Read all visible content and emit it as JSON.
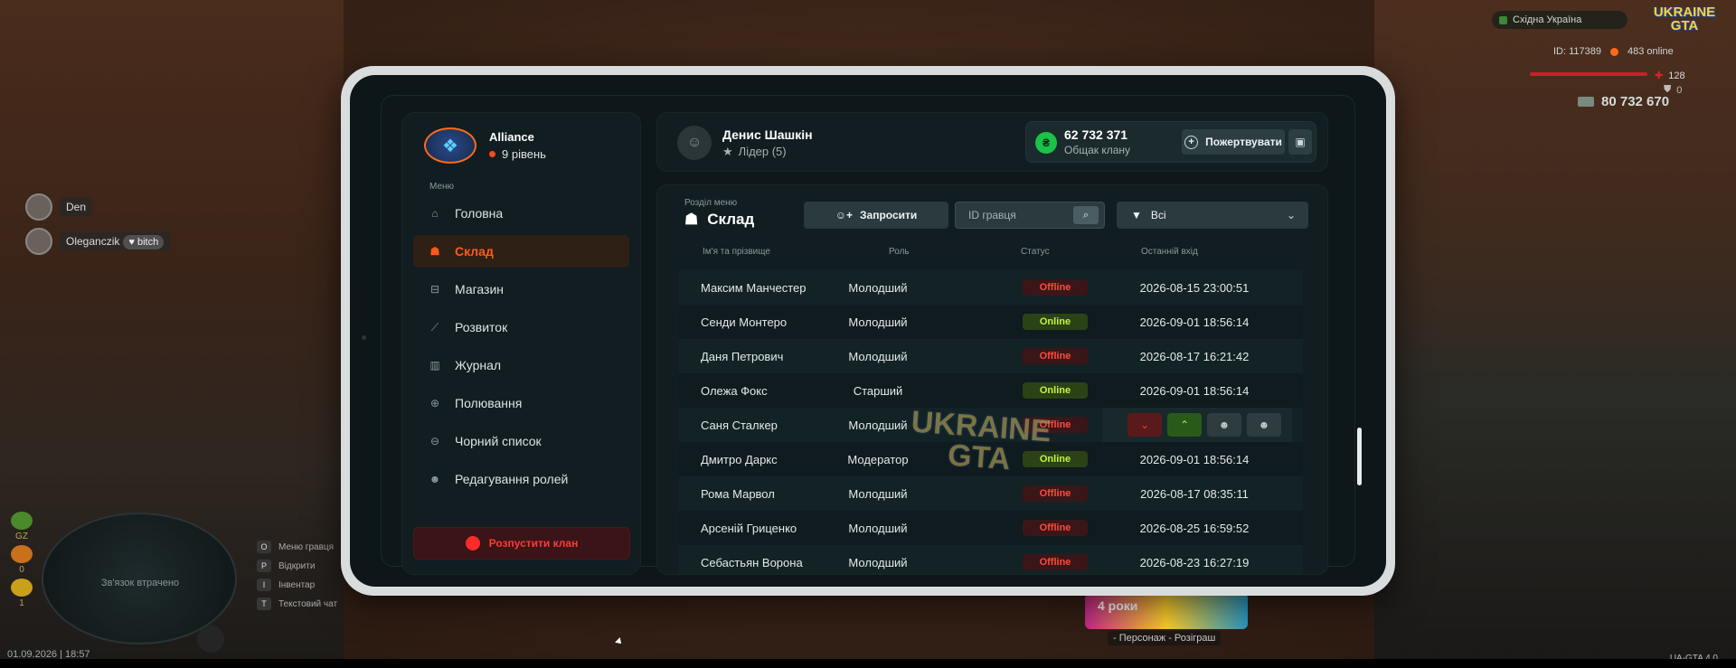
{
  "hud": {
    "region": "Східна Україна",
    "logo_text": "UKRAINE GTA",
    "player_id": "ID: 117389",
    "online": "483 online",
    "health": "128",
    "armor": "0",
    "money": "80 732 670",
    "datetime": "01.09.2026 | 18:57",
    "version": "UA-GTA 4.0",
    "minimap_status": "Зв'язок втрачено",
    "status_labels": [
      "GZ",
      "0",
      "1"
    ],
    "keyhints": [
      {
        "key": "O",
        "label": "Меню гравця"
      },
      {
        "key": "P",
        "label": "Відкрити"
      },
      {
        "key": "I",
        "label": "Інвентар"
      },
      {
        "key": "T",
        "label": "Текстовий чат"
      }
    ],
    "promo_text": "4 роки",
    "promo_caption": "- Персонаж - Розіграш"
  },
  "voice": [
    {
      "name": "Den",
      "tag": ""
    },
    {
      "name": "Oleganczik",
      "tag": "bitch"
    }
  ],
  "clan": {
    "name": "Alliance",
    "level": "9 рівень"
  },
  "menu": {
    "label": "Меню",
    "items": [
      {
        "label": "Головна",
        "icon": "home-icon",
        "active": false
      },
      {
        "label": "Склад",
        "icon": "members-icon",
        "active": true
      },
      {
        "label": "Магазин",
        "icon": "basket-icon",
        "active": false
      },
      {
        "label": "Розвиток",
        "icon": "chart-icon",
        "active": false
      },
      {
        "label": "Журнал",
        "icon": "book-icon",
        "active": false
      },
      {
        "label": "Полювання",
        "icon": "crosshair-icon",
        "active": false
      },
      {
        "label": "Чорний список",
        "icon": "block-icon",
        "active": false
      },
      {
        "label": "Редагування ролей",
        "icon": "user-edit-icon",
        "active": false
      }
    ],
    "disband": "Розпустити клан"
  },
  "leader": {
    "name": "Денис Шашкін",
    "role": "Лідер (5)"
  },
  "fund": {
    "amount": "62 732 371",
    "label": "Общак клану",
    "donate": "Пожертвувати"
  },
  "section": {
    "label": "Розділ меню",
    "title": "Склад",
    "invite": "Запросити",
    "search_placeholder": "ID гравця",
    "filter": "Всі"
  },
  "table": {
    "headers": [
      "Ім'я та прізвище",
      "Роль",
      "Статус",
      "Останній вхід"
    ],
    "rows": [
      {
        "name": "Максим Манчестер",
        "role": "Молодший",
        "status": "Offline",
        "last": "2026-08-15 23:00:51"
      },
      {
        "name": "Сенди Монтеро",
        "role": "Молодший",
        "status": "Online",
        "last": "2026-09-01 18:56:14"
      },
      {
        "name": "Даня Петрович",
        "role": "Молодший",
        "status": "Offline",
        "last": "2026-08-17 16:21:42"
      },
      {
        "name": "Олежа Фокс",
        "role": "Старший",
        "status": "Online",
        "last": "2026-09-01 18:56:14"
      },
      {
        "name": "Саня Сталкер",
        "role": "Молодший",
        "status": "Offline",
        "last": "",
        "actions": true
      },
      {
        "name": "Дмитро Даркс",
        "role": "Модератор",
        "status": "Online",
        "last": "2026-09-01 18:56:14"
      },
      {
        "name": "Рома Марвол",
        "role": "Молодший",
        "status": "Offline",
        "last": "2026-08-17 08:35:11"
      },
      {
        "name": "Арсеній Гриценко",
        "role": "Молодший",
        "status": "Offline",
        "last": "2026-08-25 16:59:52"
      },
      {
        "name": "Себастьян Ворона",
        "role": "Молодший",
        "status": "Offline",
        "last": "2026-08-23 16:27:19"
      }
    ]
  },
  "watermark": "UKRAINE GTA"
}
